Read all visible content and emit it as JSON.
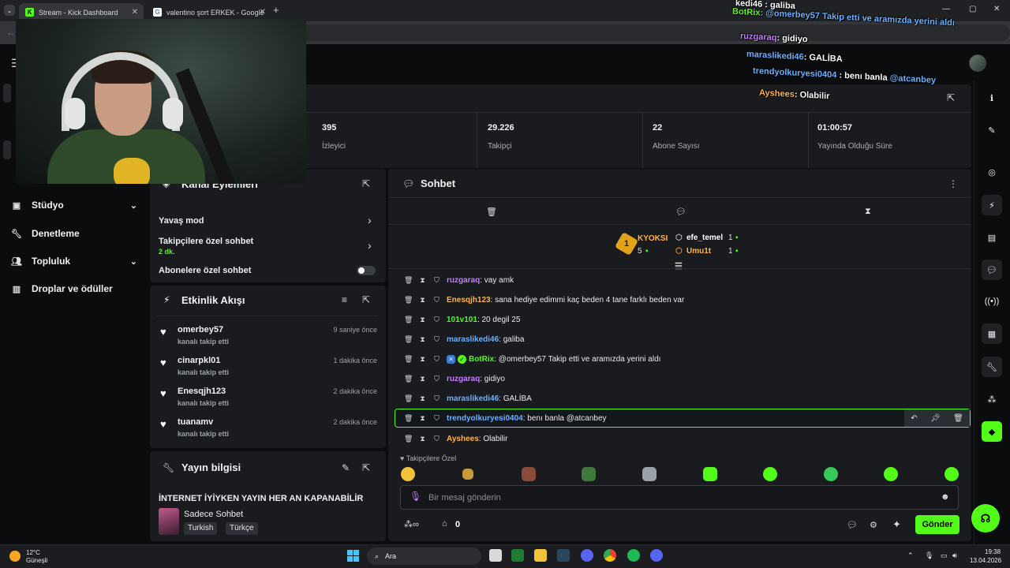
{
  "browser": {
    "tabs": [
      {
        "label": "Stream - Kick Dashboard",
        "fav_letter": "K"
      },
      {
        "label": "valentino şort ERKEK - Google"
      }
    ],
    "new_tab": "+",
    "controls": [
      "—",
      "▢",
      "✕"
    ]
  },
  "nav": {
    "items": [
      {
        "label": "Stüdyo",
        "icon": "video-icon",
        "has_chevron": true
      },
      {
        "label": "Denetleme",
        "icon": "wrench-icon",
        "has_chevron": false
      },
      {
        "label": "Topluluk",
        "icon": "users-icon",
        "has_chevron": true
      },
      {
        "label": "Droplar ve ödüller",
        "icon": "gift-icon",
        "has_chevron": false
      }
    ]
  },
  "overlay_chat": [
    {
      "text": "kedi46 : galiba"
    },
    {
      "user": "BotRix",
      "text": ": @omerbey57 Takip etti ve aramızda yerini aldı"
    },
    {
      "user": "ruzgaraq",
      "text": ": gidiyo"
    },
    {
      "user": "maraslikedi46",
      "text": ": GALİBA"
    },
    {
      "user": "trendyolkuryesi0404",
      "text": ": benı banla",
      "mention": "@atcanbey"
    },
    {
      "user": "Ayshees",
      "text": ": Olabilir"
    }
  ],
  "stats": [
    {
      "value": "395",
      "label": "İzleyici"
    },
    {
      "value": "29.226",
      "label": "Takipçi"
    },
    {
      "value": "22",
      "label": "Abone Sayısı"
    },
    {
      "value": "01:00:57",
      "label": "Yayında Olduğu Süre"
    }
  ],
  "channel_actions": {
    "title": "Kanal Eylemleri",
    "rows": [
      {
        "label": "Yavaş mod"
      },
      {
        "label": "Takipçilere özel sohbet",
        "sub": "2 dk."
      },
      {
        "label": "Abonelere özel sohbet"
      }
    ]
  },
  "activity": {
    "title": "Etkinlik Akışı",
    "events": [
      {
        "name": "omerbey57",
        "sub": "kanalı takip etti",
        "time": "9 saniye önce"
      },
      {
        "name": "cinarpkl01",
        "sub": "kanalı takip etti",
        "time": "1 dakika önce"
      },
      {
        "name": "Enesqjh123",
        "sub": "kanalı takip etti",
        "time": "2 dakika önce"
      },
      {
        "name": "tuanamv",
        "sub": "kanalı takip etti",
        "time": "2 dakika önce"
      }
    ]
  },
  "stream_info": {
    "title": "Yayın bilgisi",
    "stream_title": "İNTERNET İYİYKEN YAYIN HER AN KAPANABİLİR",
    "category": "Sadece Sohbet",
    "tags": [
      "Turkish",
      "Türkçe"
    ]
  },
  "chat": {
    "title": "Sohbet",
    "pinned": {
      "top_user": "KYOKSI",
      "top_rank": "1",
      "top_count": "5",
      "others": [
        {
          "name": "efe_temel",
          "count": "1"
        },
        {
          "name": "Umu1t",
          "count": "1"
        }
      ]
    },
    "messages": [
      {
        "user": "ruzgaraq",
        "text": ": vay amk",
        "color": "#c67cff"
      },
      {
        "user": "Enesqjh123",
        "text": ": sana hediye edimmi kaç beden 4 tane farklı beden var",
        "color": "#ffb347"
      },
      {
        "user": "101v101",
        "text": ": 20 degil 25",
        "color": "#53fc18"
      },
      {
        "user": "maraslikedi46",
        "text": ": galiba",
        "color": "#6ab0ff"
      },
      {
        "user": "BotRix",
        "text": ": @omerbey57 Takip etti ve aramızda yerini aldı",
        "color": "#53fc18"
      },
      {
        "user": "ruzgaraq",
        "text": ": gidiyo",
        "color": "#c67cff"
      },
      {
        "user": "maraslikedi46",
        "text": ": GALİBA",
        "color": "#6ab0ff"
      },
      {
        "user": "trendyolkuryesi0404",
        "text": ": benı banla @atcanbey",
        "color": "#6ab0ff"
      },
      {
        "user": "Ayshees",
        "text": ": Olabilir",
        "color": "#ffb347"
      }
    ],
    "emote_label": "Takipçilere Özel",
    "input_placeholder": "Bir mesaj gönderin",
    "points": "0",
    "send_label": "Gönder"
  },
  "taskbar": {
    "weather_temp": "12°C",
    "weather_desc": "Güneşli",
    "search_label": "Ara",
    "time": "19:38",
    "date": "13.04.2026"
  }
}
